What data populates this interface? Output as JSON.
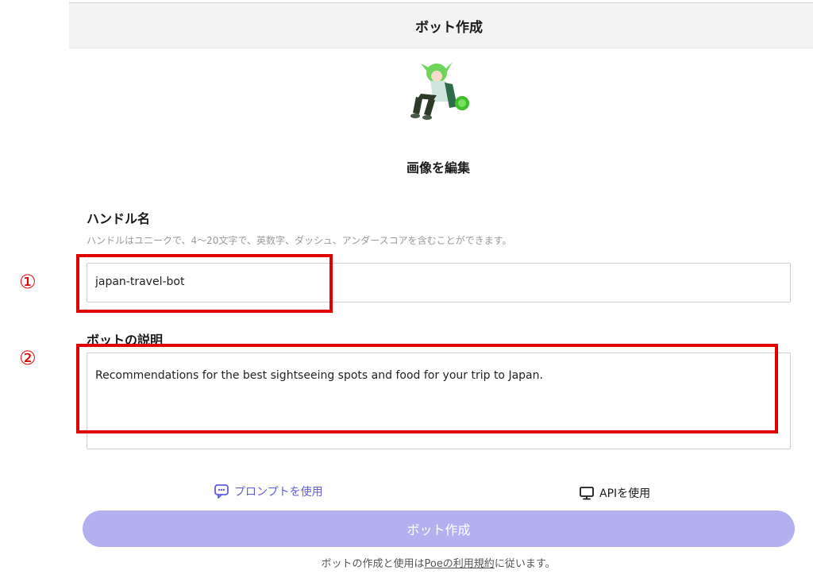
{
  "header": {
    "title": "ボット作成"
  },
  "avatar": {
    "icon": "anime-character-avatar"
  },
  "edit_image_label": "画像を編集",
  "handle": {
    "label": "ハンドル名",
    "hint": "ハンドルはユニークで、4～20文字で、英数字、ダッシュ、アンダースコアを含むことができます。",
    "value": "japan-travel-bot"
  },
  "description": {
    "label": "ボットの説明",
    "value": "Recommendations for the best sightseeing spots and food for your trip to Japan."
  },
  "annotations": {
    "marker_1": "①",
    "marker_2": "②",
    "color": "#e00000"
  },
  "actions": {
    "use_prompt": "プロンプトを使用",
    "use_api": "APIを使用",
    "create_button": "ボット作成"
  },
  "terms": {
    "prefix": "ボットの作成と使用は",
    "link": "Poeの利用規約",
    "suffix": "に従います。"
  },
  "colors": {
    "accent": "#5d5cde",
    "button_disabled": "#b3b0ef"
  }
}
